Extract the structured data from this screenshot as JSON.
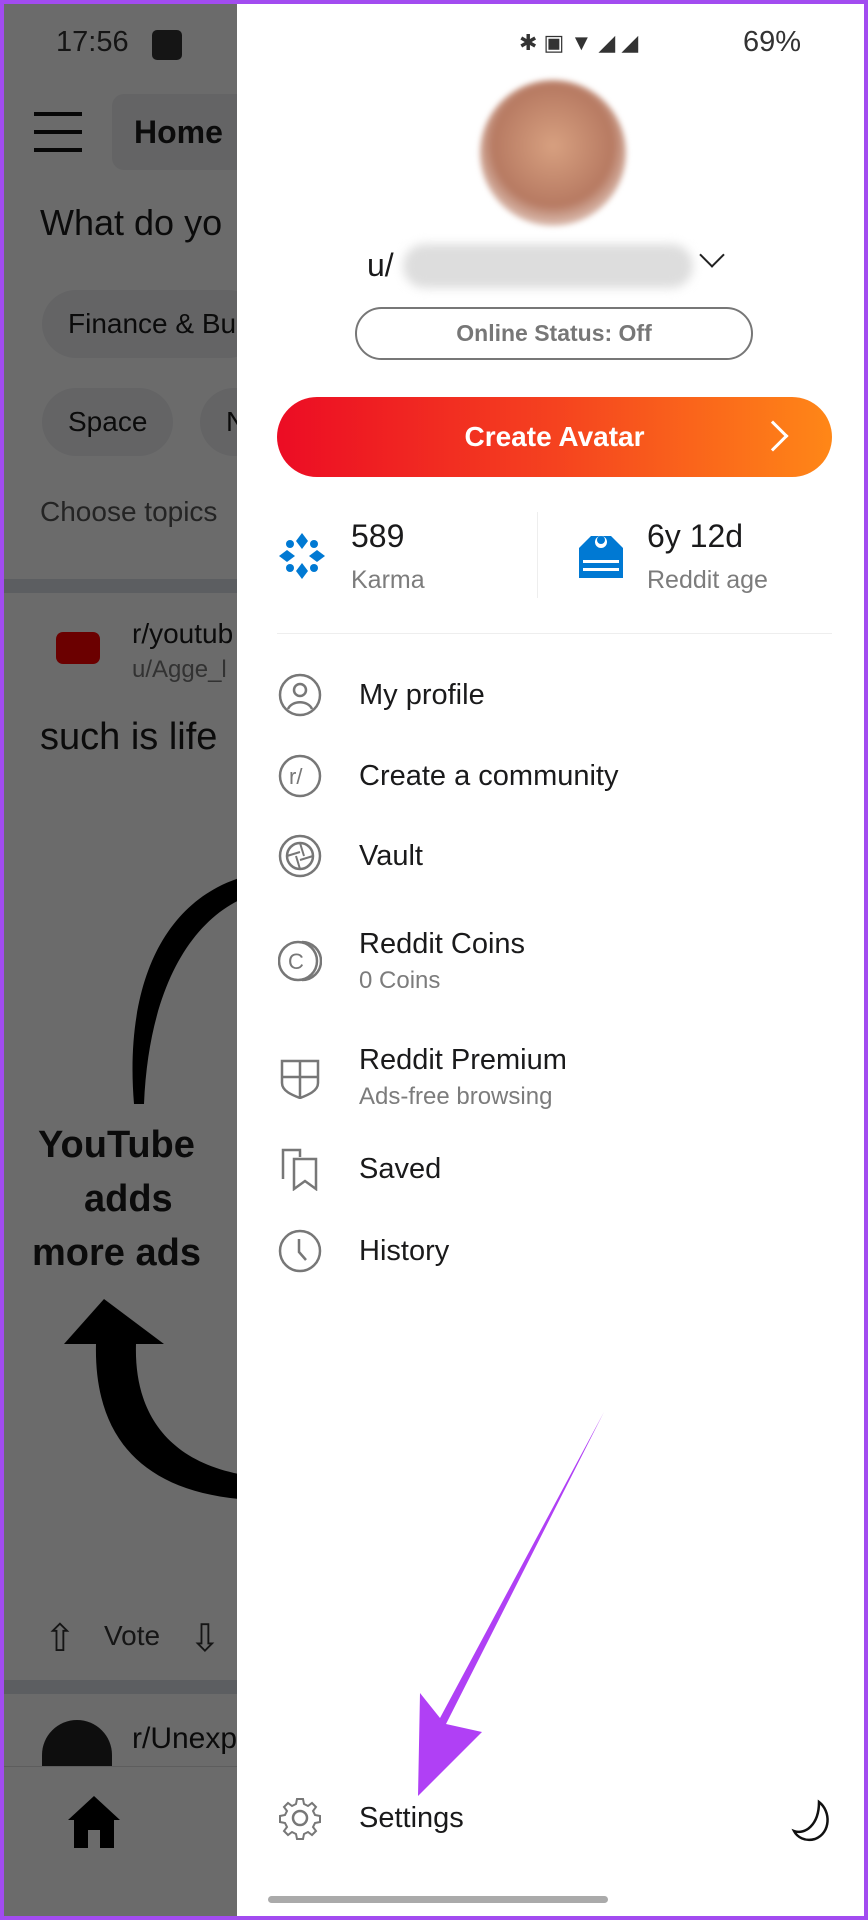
{
  "status_bar": {
    "time": "17:56",
    "battery": "69%"
  },
  "background": {
    "home_label": "Home",
    "prompt": "What do yo",
    "chips": [
      "Finance & Bu",
      "Space",
      "N"
    ],
    "choose_topics": "Choose topics",
    "post": {
      "subreddit": "r/youtub",
      "user": "u/Agge_l",
      "title": "such is life",
      "image_lines": [
        "YouTube",
        "adds",
        "more ads"
      ],
      "vote_label": "Vote"
    },
    "next_post_subreddit": "r/Unexp"
  },
  "drawer": {
    "username_prefix": "u/",
    "online_status": "Online Status: Off",
    "create_avatar": "Create Avatar",
    "stats": [
      {
        "value": "589",
        "label": "Karma"
      },
      {
        "value": "6y 12d",
        "label": "Reddit age"
      }
    ],
    "menu": [
      {
        "label": "My profile",
        "icon": "user-circle-icon"
      },
      {
        "label": "Create a community",
        "icon": "community-icon"
      },
      {
        "label": "Vault",
        "icon": "vault-icon"
      },
      {
        "label": "Reddit Coins",
        "sub": "0 Coins",
        "icon": "coins-icon"
      },
      {
        "label": "Reddit Premium",
        "sub": "Ads-free browsing",
        "icon": "shield-icon"
      },
      {
        "label": "Saved",
        "icon": "bookmark-icon"
      },
      {
        "label": "History",
        "icon": "clock-icon"
      }
    ],
    "settings": "Settings"
  },
  "colors": {
    "accent_start": "#ec0c24",
    "accent_end": "#ff8717",
    "stat_icon": "#0079d3",
    "annotation_arrow": "#b040f5"
  }
}
